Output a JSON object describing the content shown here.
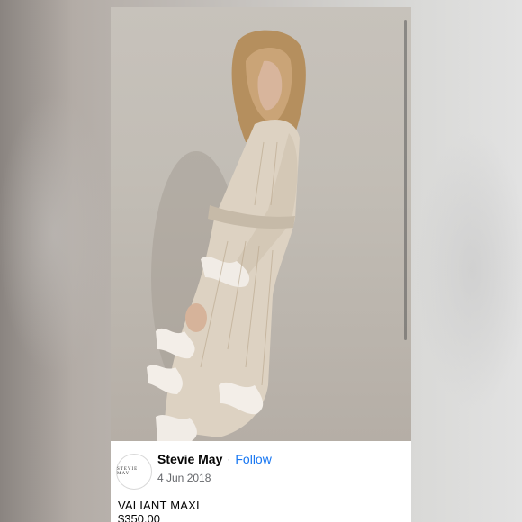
{
  "post": {
    "shop_name": "Stevie May",
    "separator": "·",
    "follow_label": "Follow",
    "date": "4 Jun 2018",
    "avatar_logo_text": "STEVIE MAY"
  },
  "product": {
    "title": "VALIANT MAXI",
    "price": "$350.00"
  },
  "colors": {
    "link": "#1877f2",
    "text": "#050505",
    "secondary": "#65676b"
  },
  "icons": [
    "shop-logo"
  ]
}
